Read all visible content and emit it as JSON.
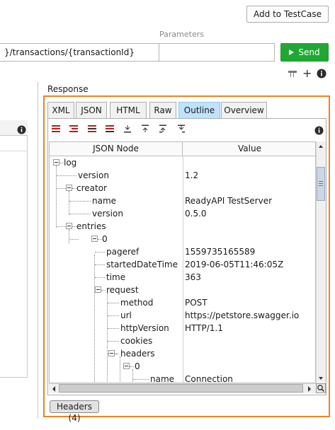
{
  "toolbar": {
    "add_to_testcase": "Add to TestCase"
  },
  "request": {
    "parameters_label": "Parameters",
    "url_value": "}/transactions/{transactionId}",
    "parameter_value": "",
    "send_label": "Send"
  },
  "response": {
    "label": "Response",
    "tabs": [
      "XML",
      "JSON",
      "HTML",
      "Raw",
      "Outline",
      "Overview"
    ],
    "active_tab": "Outline",
    "columns": {
      "node": "JSON Node",
      "value": "Value"
    },
    "rows": [
      {
        "name": "log",
        "value": ""
      },
      {
        "name": "version",
        "value": "1.2"
      },
      {
        "name": "creator",
        "value": ""
      },
      {
        "name": "name",
        "value": "ReadyAPI TestServer"
      },
      {
        "name": "version",
        "value": "0.5.0"
      },
      {
        "name": "entries",
        "value": ""
      },
      {
        "name": "0",
        "value": ""
      },
      {
        "name": "pageref",
        "value": "1559735165589"
      },
      {
        "name": "startedDateTime",
        "value": "2019-06-05T11:46:05Z"
      },
      {
        "name": "time",
        "value": "363"
      },
      {
        "name": "request",
        "value": ""
      },
      {
        "name": "method",
        "value": "POST"
      },
      {
        "name": "url",
        "value": "https://petstore.swagger.io"
      },
      {
        "name": "httpVersion",
        "value": "HTTP/1.1"
      },
      {
        "name": "cookies",
        "value": ""
      },
      {
        "name": "headers",
        "value": ""
      },
      {
        "name": "0",
        "value": ""
      },
      {
        "name": "name",
        "value": "Connection"
      }
    ],
    "bottom_tab": "Headers (4)"
  },
  "colors": {
    "send": "#21a834",
    "highlight": "#f0821e",
    "active_tab": "#bfe3fb"
  }
}
